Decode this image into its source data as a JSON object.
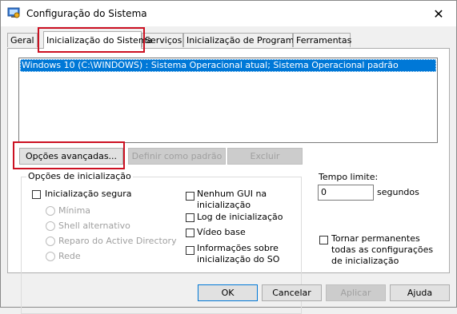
{
  "window": {
    "title": "Configuração do Sistema",
    "close_label": "✕"
  },
  "tabs": [
    {
      "label": "Geral"
    },
    {
      "label": "Inicialização do Sistema"
    },
    {
      "label": "Serviços"
    },
    {
      "label": "Inicialização de Programas"
    },
    {
      "label": "Ferramentas"
    }
  ],
  "boot_list": {
    "selected_entry": "Windows 10 (C:\\WINDOWS) : Sistema Operacional atual; Sistema Operacional padrão"
  },
  "boot_buttons": {
    "advanced": "Opções avançadas...",
    "set_default": "Definir como padrão",
    "delete": "Excluir"
  },
  "boot_options": {
    "legend": "Opções de inicialização",
    "safe_boot": "Inicialização segura",
    "minimal": "Mínima",
    "alternate_shell": "Shell alternativo",
    "ad_repair": "Reparo do Active Directory",
    "network": "Rede",
    "no_gui": "Nenhum GUI na inicialização",
    "boot_log": "Log de inicialização",
    "base_video": "Vídeo base",
    "os_boot_info": "Informações sobre inicialização do SO"
  },
  "timeout": {
    "label": "Tempo limite:",
    "value": "0",
    "unit": "segundos"
  },
  "permanent": {
    "label": "Tornar permanentes todas as configurações de inicialização"
  },
  "footer": {
    "ok": "OK",
    "cancel": "Cancelar",
    "apply": "Aplicar",
    "help": "Ajuda"
  },
  "colors": {
    "selection": "#0078d7",
    "highlight_box": "#cc1122"
  }
}
